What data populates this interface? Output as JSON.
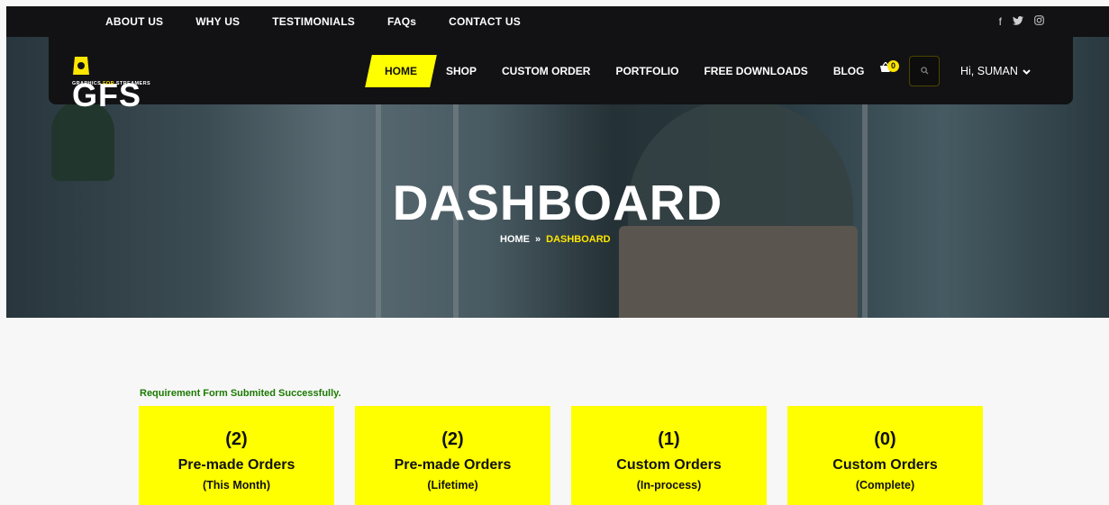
{
  "topbar": {
    "links": [
      "ABOUT US",
      "WHY US",
      "TESTIMONIALS",
      "FAQs",
      "CONTACT US"
    ],
    "social_icons": [
      "facebook-icon",
      "twitter-icon",
      "instagram-icon"
    ]
  },
  "logo": {
    "mark": "GFS",
    "tagline_a": "GRAPHICS ",
    "tagline_b": "FOR",
    "tagline_c": " STREAMERS"
  },
  "nav": {
    "items": [
      {
        "label": "HOME",
        "active": true
      },
      {
        "label": "SHOP"
      },
      {
        "label": "CUSTOM ORDER"
      },
      {
        "label": "PORTFOLIO"
      },
      {
        "label": "FREE DOWNLOADS"
      },
      {
        "label": "BLOG"
      }
    ],
    "cart_count": "0",
    "user_greeting": "Hi, SUMAN"
  },
  "hero": {
    "title": "DASHBOARD",
    "crumb_home": "HOME",
    "crumb_sep": "»",
    "crumb_current": "DASHBOARD"
  },
  "message": "Requirement Form Submited Successfully.",
  "cards": [
    {
      "count": "(2)",
      "title": "Pre-made Orders",
      "sub": "(This Month)"
    },
    {
      "count": "(2)",
      "title": "Pre-made Orders",
      "sub": "(Lifetime)"
    },
    {
      "count": "(1)",
      "title": "Custom Orders",
      "sub": "(In-process)"
    },
    {
      "count": "(0)",
      "title": "Custom Orders",
      "sub": "(Complete)"
    }
  ],
  "colors": {
    "accent": "#ffff00",
    "dark": "#121214",
    "success": "#1a7a00"
  }
}
